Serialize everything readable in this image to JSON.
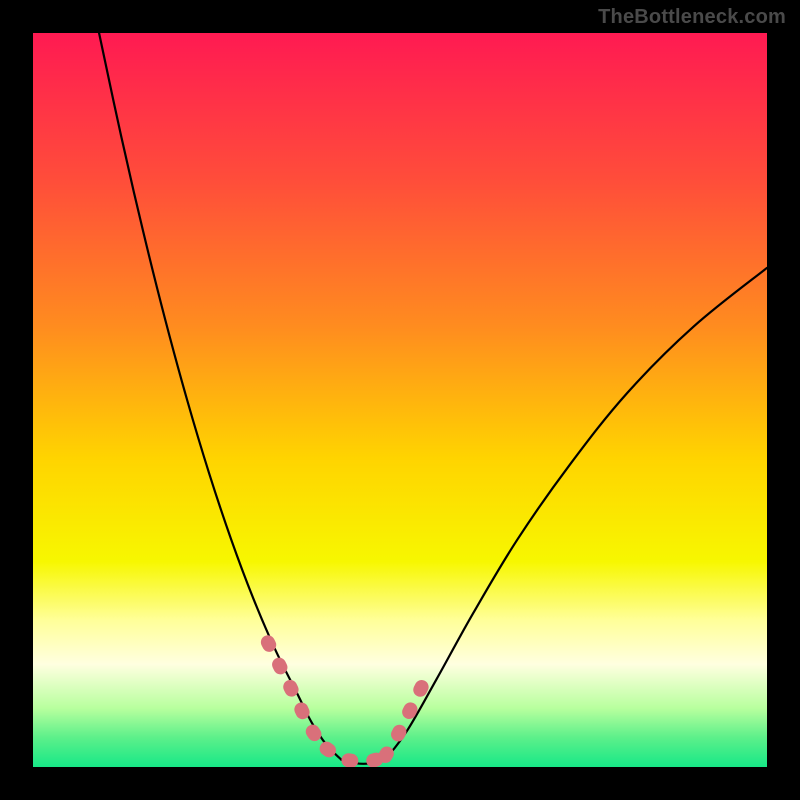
{
  "watermark": "TheBottleneck.com",
  "chart_data": {
    "type": "line",
    "title": "",
    "xlabel": "",
    "ylabel": "",
    "xlim": [
      0,
      100
    ],
    "ylim": [
      0,
      100
    ],
    "grid": false,
    "legend": false,
    "background_gradient": {
      "stops": [
        {
          "offset": 0.0,
          "color": "#ff1a52"
        },
        {
          "offset": 0.2,
          "color": "#ff4d3a"
        },
        {
          "offset": 0.4,
          "color": "#ff8c1f"
        },
        {
          "offset": 0.58,
          "color": "#ffd400"
        },
        {
          "offset": 0.72,
          "color": "#f7f700"
        },
        {
          "offset": 0.8,
          "color": "#ffff99"
        },
        {
          "offset": 0.86,
          "color": "#ffffe0"
        },
        {
          "offset": 0.92,
          "color": "#b8ff9e"
        },
        {
          "offset": 0.96,
          "color": "#5cf08a"
        },
        {
          "offset": 1.0,
          "color": "#17e887"
        }
      ]
    },
    "series": [
      {
        "name": "bottleneck-curve-left",
        "x": [
          9,
          12,
          15,
          18,
          21,
          24,
          27,
          30,
          33,
          36,
          38,
          40,
          42
        ],
        "y": [
          100,
          86,
          73,
          61,
          50,
          40,
          31,
          23,
          16,
          10,
          6,
          3,
          1
        ]
      },
      {
        "name": "bottleneck-curve-right",
        "x": [
          48,
          51,
          55,
          60,
          66,
          73,
          81,
          90,
          100
        ],
        "y": [
          1,
          5,
          12,
          21,
          31,
          41,
          51,
          60,
          68
        ]
      },
      {
        "name": "bottleneck-flat-bottom",
        "x": [
          42,
          44,
          46,
          48
        ],
        "y": [
          1,
          0.5,
          0.5,
          1
        ]
      }
    ],
    "highlight_segments": [
      {
        "name": "highlight-left-descent",
        "color": "#d9707a",
        "points": [
          {
            "x": 32,
            "y": 17
          },
          {
            "x": 34,
            "y": 13
          },
          {
            "x": 36,
            "y": 9
          },
          {
            "x": 38,
            "y": 5
          },
          {
            "x": 40,
            "y": 2.5
          }
        ]
      },
      {
        "name": "highlight-bottom",
        "color": "#d9707a",
        "points": [
          {
            "x": 40,
            "y": 2.5
          },
          {
            "x": 42,
            "y": 1.2
          },
          {
            "x": 44,
            "y": 0.8
          },
          {
            "x": 46,
            "y": 0.8
          },
          {
            "x": 48,
            "y": 1.5
          }
        ]
      },
      {
        "name": "highlight-right-ascent",
        "color": "#d9707a",
        "points": [
          {
            "x": 48,
            "y": 1.5
          },
          {
            "x": 49.5,
            "y": 4
          },
          {
            "x": 51,
            "y": 7
          },
          {
            "x": 52.5,
            "y": 10
          },
          {
            "x": 54,
            "y": 13
          }
        ]
      }
    ]
  }
}
